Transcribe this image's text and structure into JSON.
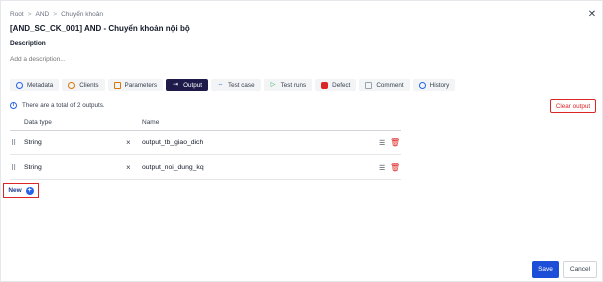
{
  "breadcrumb": {
    "items": [
      "Root",
      "AND",
      "Chuyển khoản"
    ],
    "separator": ">"
  },
  "close_icon": "close-icon",
  "title": "[AND_SC_CK_001] AND - Chuyển khoản nội bộ",
  "description": {
    "label": "Description",
    "placeholder": "Add a description..."
  },
  "tabs": [
    {
      "label": "Metadata",
      "icon": "metadata-icon",
      "active": false
    },
    {
      "label": "Clients",
      "icon": "clients-icon",
      "active": false
    },
    {
      "label": "Parameters",
      "icon": "parameters-icon",
      "active": false
    },
    {
      "label": "Output",
      "icon": "output-icon",
      "active": true
    },
    {
      "label": "Test case",
      "icon": "test-case-icon",
      "active": false
    },
    {
      "label": "Test runs",
      "icon": "play-icon",
      "active": false
    },
    {
      "label": "Defect",
      "icon": "bug-icon",
      "active": false
    },
    {
      "label": "Comment",
      "icon": "comment-icon",
      "active": false
    },
    {
      "label": "History",
      "icon": "history-icon",
      "active": false
    }
  ],
  "info_text": "There are a total of 2 outputs.",
  "clear_button": "Clear output",
  "table": {
    "headers": [
      "Data type",
      "Name"
    ],
    "rows": [
      {
        "type": "String",
        "name": "output_tb_giao_dich"
      },
      {
        "type": "String",
        "name": "output_noi_dung_kq"
      }
    ]
  },
  "new_button": "New",
  "footer": {
    "save": "Save",
    "cancel": "Cancel"
  },
  "colors": {
    "accent": "#1e1b4b",
    "primary": "#1d4ed8",
    "danger": "#dc2626"
  }
}
